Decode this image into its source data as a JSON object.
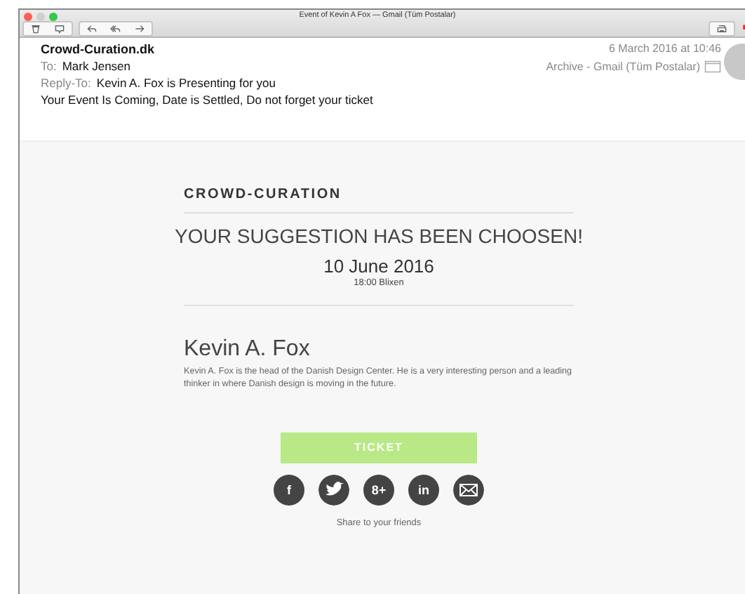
{
  "window": {
    "title": "Event of Kevin A Fox — Gmail (Tüm Postalar)"
  },
  "header": {
    "from": "Crowd-Curation.dk",
    "to_label": "To:",
    "to": "Mark Jensen",
    "reply_label": "Reply-To:",
    "reply_to": "Kevin A. Fox is Presenting for you",
    "subject": "Your Event Is Coming, Date is Settled, Do not forget your ticket",
    "date": "6 March 2016 at 10:46",
    "mailbox": "Archive - Gmail (Tüm Postalar)"
  },
  "email": {
    "brand": "CROWD-CURATION",
    "headline": "YOUR SUGGESTION HAS BEEN CHOOSEN!",
    "date": "10 June 2016",
    "time_place": "18:00 Blixen",
    "speaker": "Kevin A. Fox",
    "bio": "Kevin A. Fox is the head of the Danish Design Center. He is a very interesting person and a leading thinker in where Danish design is moving in the future.",
    "button": "TICKET",
    "social": [
      {
        "kind": "text",
        "label": "f"
      },
      {
        "kind": "bird"
      },
      {
        "kind": "text",
        "label": "8+"
      },
      {
        "kind": "text",
        "label": "in"
      },
      {
        "kind": "mail"
      }
    ],
    "share": "Share to your friends"
  }
}
